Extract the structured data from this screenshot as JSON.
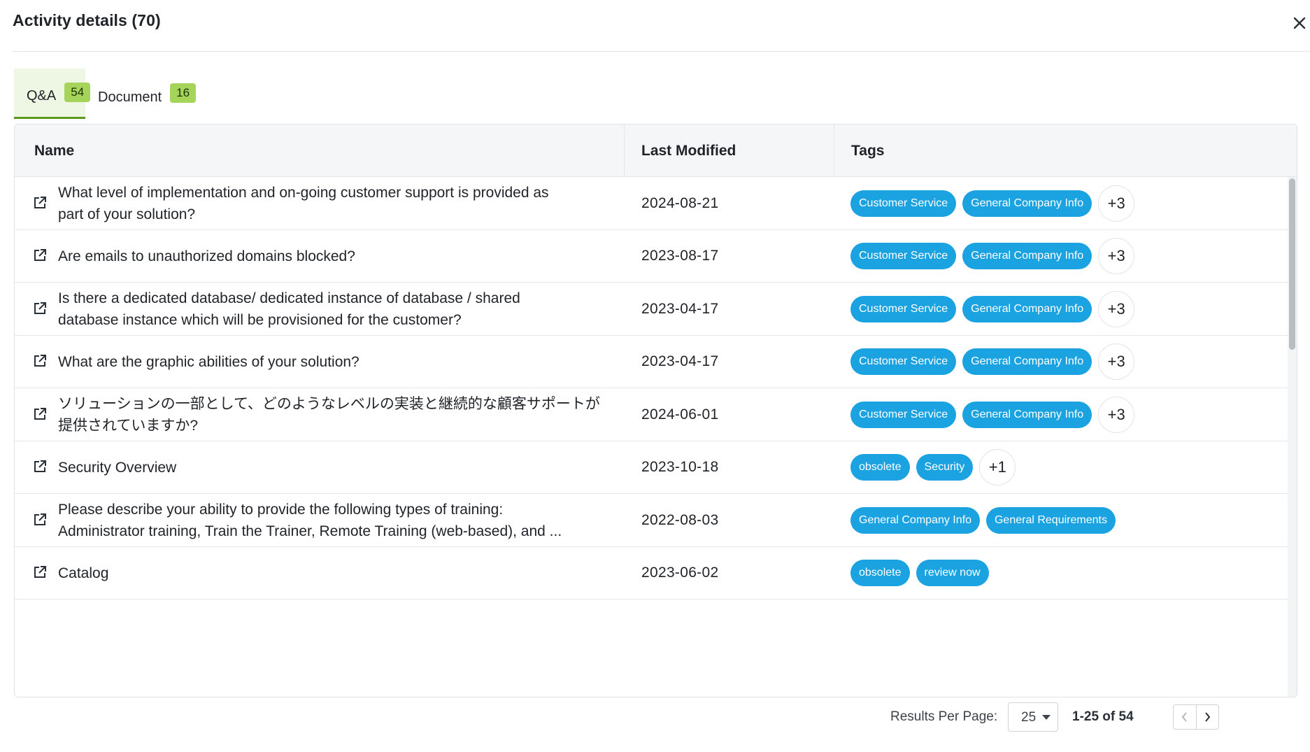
{
  "modal": {
    "title": "Activity details (70)",
    "close_icon": "close-icon"
  },
  "tabs": [
    {
      "label": "Q&A",
      "count": "54",
      "active": true
    },
    {
      "label": "Document",
      "count": "16",
      "active": false
    }
  ],
  "table": {
    "columns": [
      "Name",
      "Last Modified",
      "Tags"
    ],
    "rows": [
      {
        "name_line1": "What level of implementation and on-going customer support is provided as",
        "name_line2": "part of your solution?",
        "date": "2024-08-21",
        "tags": [
          "Customer Service",
          "General Company Info"
        ],
        "more": "+3"
      },
      {
        "name_line1": "Are emails to unauthorized domains blocked?",
        "name_line2": "",
        "date": "2023-08-17",
        "tags": [
          "Customer Service",
          "General Company Info"
        ],
        "more": "+3"
      },
      {
        "name_line1": "Is there a dedicated database/ dedicated instance of database / shared",
        "name_line2": "database instance which will be provisioned for the customer?",
        "date": "2023-04-17",
        "tags": [
          "Customer Service",
          "General Company Info"
        ],
        "more": "+3"
      },
      {
        "name_line1": "What are the graphic abilities of your solution?",
        "name_line2": "",
        "date": "2023-04-17",
        "tags": [
          "Customer Service",
          "General Company Info"
        ],
        "more": "+3"
      },
      {
        "name_line1": "ソリューションの一部として、どのようなレベルの実装と継続的な顧客サポートが",
        "name_line2": "提供されていますか?",
        "date": "2024-06-01",
        "tags": [
          "Customer Service",
          "General Company Info"
        ],
        "more": "+3"
      },
      {
        "name_line1": "Security Overview",
        "name_line2": "",
        "date": "2023-10-18",
        "tags": [
          "obsolete",
          "Security"
        ],
        "more": "+1"
      },
      {
        "name_line1": "Please describe your ability to provide the following types of training:",
        "name_line2": "Administrator training, Train the Trainer, Remote Training (web-based), and ...",
        "date": "2022-08-03",
        "tags": [
          "General Company Info",
          "General Requirements"
        ],
        "more": ""
      },
      {
        "name_line1": "Catalog",
        "name_line2": "",
        "date": "2023-06-02",
        "tags": [
          "obsolete",
          "review now"
        ],
        "more": ""
      }
    ]
  },
  "pagination": {
    "results_per_page_label": "Results Per Page:",
    "per_page_value": "25",
    "range_text": "1-25 of 54"
  },
  "colors": {
    "tag_bg": "#1aa3e0",
    "badge_bg": "#a6d45a",
    "active_tab_underline": "#5b9a1a"
  }
}
